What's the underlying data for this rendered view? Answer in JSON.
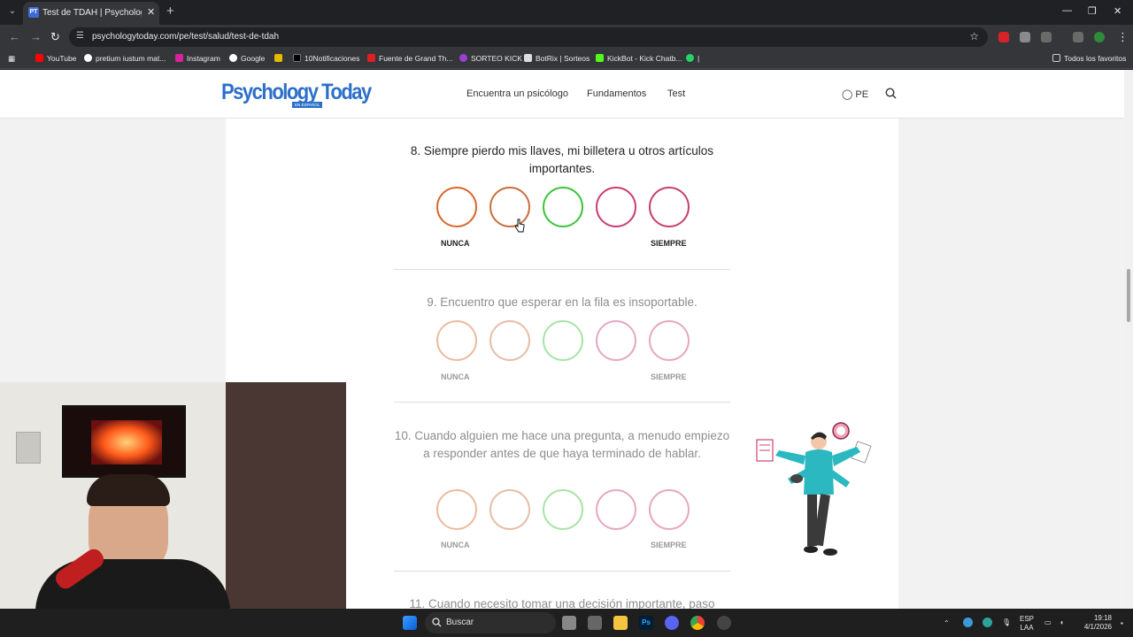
{
  "browser": {
    "tab_title": "Test de TDAH | Psychology Tod...",
    "tab_favicon": "PT",
    "url": "psychologytoday.com/pe/test/salud/test-de-tdah",
    "bookmarks": [
      "YouTube",
      "pretium iustum mat...",
      "Instagram",
      "Google",
      "10Notificaciones",
      "Fuente de Grand Th...",
      "SORTEO KICK",
      "BotRix | Sorteos",
      "KickBot - Kick Chatb...",
      "|"
    ],
    "all_bookmarks": "Todos los favoritos"
  },
  "site": {
    "logo": "Psychology Today",
    "logo_sub": "EN ESPAÑOL",
    "nav": [
      "Encuentra un psicólogo",
      "Fundamentos",
      "Test"
    ],
    "region": "PE"
  },
  "questions": [
    {
      "text": "8. Siempre pierdo mis llaves, mi billetera u otros artículos importantes.",
      "low": "NUNCA",
      "high": "SIEMPRE"
    },
    {
      "text": "9. Encuentro que esperar en la fila es insoportable.",
      "low": "NUNCA",
      "high": "SIEMPRE"
    },
    {
      "text": "10. Cuando alguien me hace una pregunta, a menudo empiezo a responder antes de que haya terminado de hablar.",
      "low": "NUNCA",
      "high": "SIEMPRE"
    },
    {
      "text": "11. Cuando necesito tomar una decisión importante, paso"
    }
  ],
  "option_colors": [
    "#d9682f",
    "#c8703f",
    "#3ec43e",
    "#cc3f78",
    "#c9406e"
  ],
  "taskbar": {
    "search": "Buscar",
    "lang": "ESP",
    "lang2": "LAA",
    "time": "19:18",
    "date": "4/1/2026"
  }
}
